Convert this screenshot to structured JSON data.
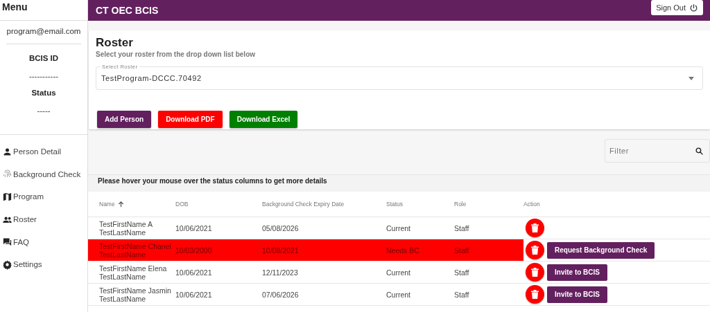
{
  "sidebar": {
    "title": "Menu",
    "email": "program@email.com",
    "fields": [
      {
        "label": "BCIS ID",
        "value": "-----------"
      },
      {
        "label": "Status",
        "value": "-----"
      }
    ],
    "items": [
      {
        "kind": "person",
        "label": "Person Detail"
      },
      {
        "kind": "fingerprint",
        "label": "Background Check"
      },
      {
        "kind": "map",
        "label": "Program"
      },
      {
        "kind": "people",
        "label": "Roster"
      },
      {
        "kind": "chat",
        "label": "FAQ"
      },
      {
        "kind": "gear",
        "label": "Settings"
      }
    ]
  },
  "header": {
    "title": "CT OEC BCIS",
    "sign_out": "Sign Out"
  },
  "roster": {
    "title": "Roster",
    "subtitle": "Select your roster from the drop down list below",
    "select": {
      "label": "Select Roster",
      "value": "TestProgram-DCCC.70492"
    },
    "buttons": [
      {
        "kind": "purple",
        "label": "Add Person"
      },
      {
        "kind": "red",
        "label": "Download PDF"
      },
      {
        "kind": "green",
        "label": "Download Excel"
      }
    ]
  },
  "filter": {
    "placeholder": "Filter"
  },
  "hint": "Please hover your mouse over the status columns to get more details",
  "table": {
    "columns": [
      {
        "label": "Name",
        "sorted": true
      },
      {
        "label": "DOB",
        "sorted": false
      },
      {
        "label": "Background Check Expiry Date",
        "sorted": false
      },
      {
        "label": "Status",
        "sorted": false
      },
      {
        "label": "Role",
        "sorted": false
      },
      {
        "label": "Action",
        "sorted": false
      }
    ],
    "rows": [
      {
        "name": "TestFirstName A TestLastName",
        "dob": "10/06/2021",
        "expiry": "05/08/2026",
        "status": "Current",
        "role": "Staff",
        "highlighted": false
      },
      {
        "name": "TestFirstName Chanel TestLastName",
        "dob": "10/03/2000",
        "expiry": "10/08/2021",
        "status": "Needs BC",
        "role": "Staff",
        "highlighted": true,
        "action": "Request Background Check"
      },
      {
        "name": "TestFirstName Elena TestLastName",
        "dob": "10/06/2021",
        "expiry": "12/11/2023",
        "status": "Current",
        "role": "Staff",
        "highlighted": false,
        "action": "Invite to BCIS"
      },
      {
        "name": "TestFirstName Jasmin TestLastName",
        "dob": "10/06/2021",
        "expiry": "07/06/2026",
        "status": "Current",
        "role": "Staff",
        "highlighted": false,
        "action": "Invite to BCIS"
      }
    ]
  }
}
